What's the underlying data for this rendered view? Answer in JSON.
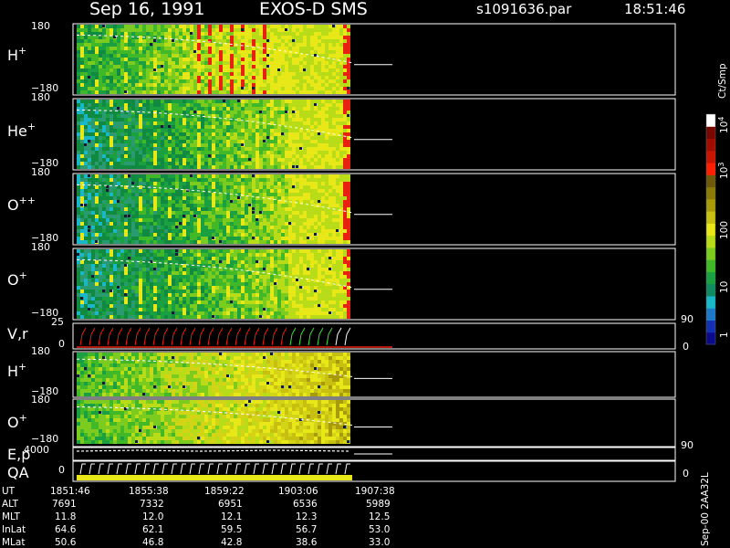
{
  "header": {
    "date": "Sep 16, 1991",
    "instrument": "EXOS-D SMS",
    "file": "s1091636.par",
    "time": "18:51:46"
  },
  "colorbar": {
    "unit": "Ct/Smp",
    "tick_labels": [
      "1",
      "10",
      "100",
      "10",
      "10"
    ],
    "tick_exponents": [
      "",
      "",
      "",
      "3",
      "4"
    ],
    "colors_low_to_high": [
      "#0a0a8a",
      "#1330b0",
      "#1e78c8",
      "#18b8c8",
      "#108a60",
      "#1aa040",
      "#40b828",
      "#7ccc20",
      "#b8dc18",
      "#e8e818",
      "#c8c010",
      "#a89a08",
      "#8a7a08",
      "#6c5a0a",
      "#ff1e00",
      "#c81400",
      "#a00c00",
      "#780800",
      "#ffffff"
    ]
  },
  "panels": [
    {
      "name": "H+",
      "label": "H",
      "sup": "+",
      "ymax": "180",
      "ymin": "−180"
    },
    {
      "name": "He+",
      "label": "He",
      "sup": "+",
      "ymax": "180",
      "ymin": "−180"
    },
    {
      "name": "O++",
      "label": "O",
      "sup": "++",
      "ymax": "180",
      "ymin": "−180"
    },
    {
      "name": "O+",
      "label": "O",
      "sup": "+",
      "ymax": "180",
      "ymin": "−180"
    }
  ],
  "vr_panel": {
    "label": "V,r",
    "ymax": "25",
    "ymin": "0",
    "right_max": "90",
    "right_min": "0"
  },
  "lower_panels": [
    {
      "name": "H+ (lower)",
      "label": "H",
      "sup": "+",
      "ymax": "180",
      "ymin": "−180"
    },
    {
      "name": "O+ (lower)",
      "label": "O",
      "sup": "+",
      "ymax": "180",
      "ymin": "−180"
    }
  ],
  "ep_panel": {
    "label": "E,p",
    "ymax": "4000",
    "ymin": "0",
    "right_max": "90",
    "right_min": "0"
  },
  "qa_panel": {
    "label": "QA"
  },
  "side_label": "Sep-00 2AA32L",
  "orbit_table": {
    "row_labels": [
      "UT",
      "ALT",
      "MLT",
      "InLat",
      "MLat"
    ],
    "columns": [
      [
        "1851:46",
        "7691",
        "11.8",
        "64.6",
        "50.6"
      ],
      [
        "1855:38",
        "7332",
        "12.0",
        "62.1",
        "46.8"
      ],
      [
        "1859:22",
        "6951",
        "12.1",
        "59.5",
        "42.8"
      ],
      [
        "1903:06",
        "6536",
        "12.3",
        "56.7",
        "38.6"
      ],
      [
        "1907:38",
        "5989",
        "12.5",
        "53.0",
        "33.0"
      ]
    ]
  },
  "chart_data": {
    "type": "heatmap",
    "title": "Sep 16, 1991   EXOS-D SMS",
    "xlabel": "UT",
    "x_ticks": [
      "1851:46",
      "1855:38",
      "1859:22",
      "1903:06",
      "1907:38"
    ],
    "series": [
      {
        "name": "H+",
        "ylim": [
          -180,
          180
        ]
      },
      {
        "name": "He+",
        "ylim": [
          -180,
          180
        ]
      },
      {
        "name": "O++",
        "ylim": [
          -180,
          180
        ]
      },
      {
        "name": "O+",
        "ylim": [
          -180,
          180
        ]
      },
      {
        "name": "V,r",
        "ylim": [
          0,
          25
        ]
      },
      {
        "name": "H+",
        "ylim": [
          -180,
          180
        ]
      },
      {
        "name": "O+",
        "ylim": [
          -180,
          180
        ]
      },
      {
        "name": "E,p",
        "ylim": [
          0,
          4000
        ]
      },
      {
        "name": "QA"
      }
    ],
    "colorbar_unit": "Ct/Smp",
    "colorbar_scale": "log",
    "colorbar_range": [
      1,
      10000
    ]
  }
}
